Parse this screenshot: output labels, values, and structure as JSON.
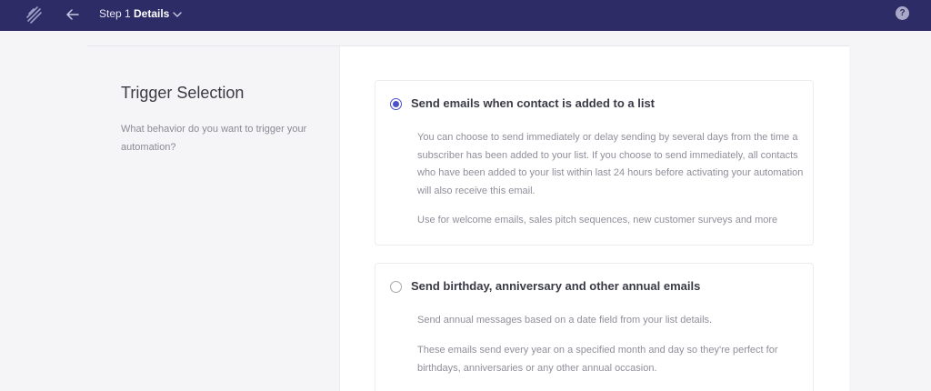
{
  "header": {
    "step_label": "Step 1",
    "step_title": "Details",
    "help_label": "?"
  },
  "sidebar": {
    "title": "Trigger Selection",
    "description": "What behavior do you want to trigger your automation?"
  },
  "options": [
    {
      "title": "Send emails when contact is added to a list",
      "selected": true,
      "paragraphs": [
        "You can choose to send immediately or delay sending by several days from the time a subscriber has been added to your list. If you choose to send immediately, all contacts who have been added to your list within last 24 hours before activating your automation will also receive this email.",
        "Use for welcome emails, sales pitch sequences, new customer surveys and more"
      ]
    },
    {
      "title": "Send birthday, anniversary and other annual emails",
      "selected": false,
      "paragraphs": [
        "Send annual messages based on a date field from your list details.",
        "These emails send every year on a specified month and day so they're perfect for birthdays, anniversaries or any other annual occasion."
      ]
    }
  ],
  "colors": {
    "header_bg": "#2e2c67",
    "accent": "#4a51c9"
  }
}
